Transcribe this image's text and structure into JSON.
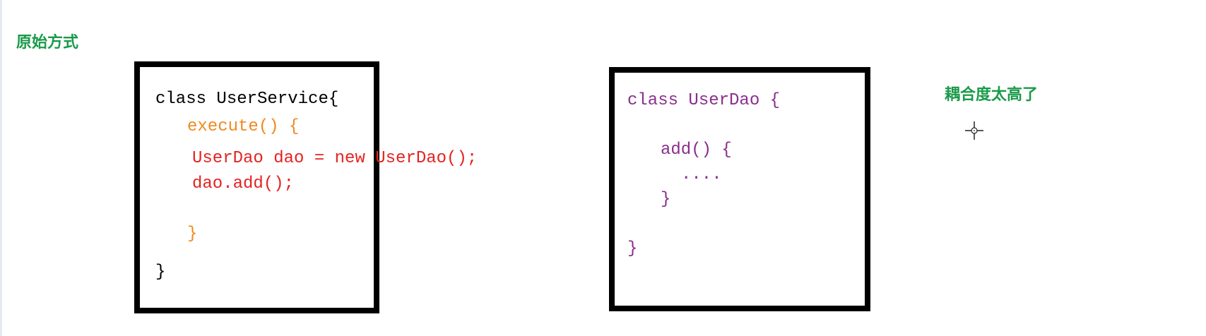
{
  "title": "原始方式",
  "note": "耦合度太高了",
  "colors": {
    "label": "#1a9a4a",
    "keyword": "#000000",
    "method": "#ef8a22",
    "call": "#e42320",
    "dao": "#8a2e8c"
  },
  "service_box": {
    "lines": [
      "class UserService{",
      "execute() {",
      "UserDao dao = new UserDao();",
      "dao.add();",
      "}",
      "}"
    ]
  },
  "dao_box": {
    "lines": [
      "class UserDao {",
      "add() {",
      "....",
      "}",
      "}"
    ]
  },
  "cursor_icon": "crosshair-icon"
}
